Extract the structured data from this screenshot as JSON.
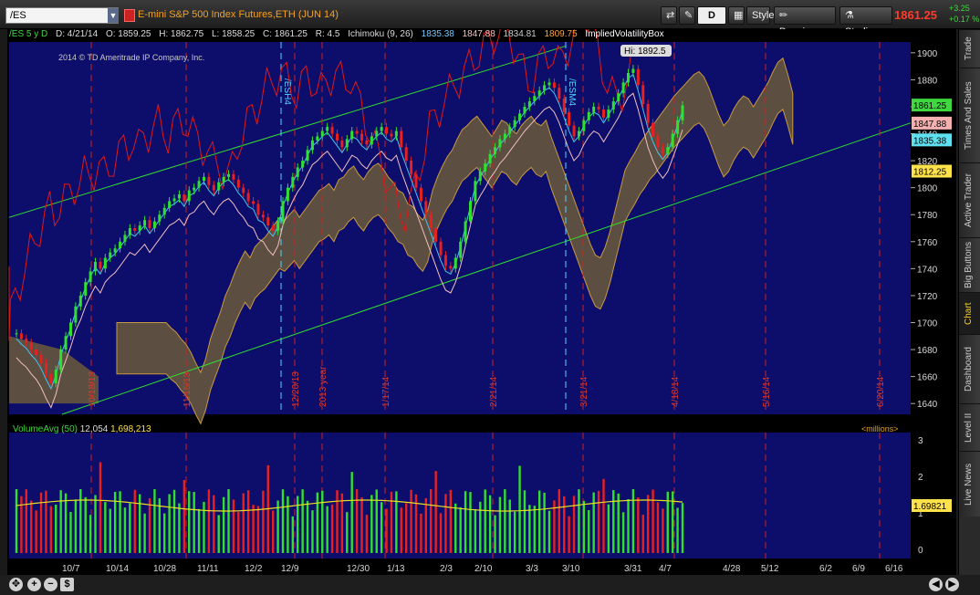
{
  "toolbar": {
    "symbol": "/ES",
    "description": "E-mini S&P 500 Index Futures,ETH (JUN 14)",
    "btn_d": "D",
    "style": "Style",
    "drawings": "Drawings",
    "studies": "Studies",
    "last": "1861.25",
    "change_pts": "+3.25",
    "change_pct": "+0.17 %"
  },
  "side_tabs": [
    "Trade",
    "Times And Sales",
    "Active Trader",
    "Big Buttons",
    "Chart",
    "Dashboard",
    "Level II",
    "Live News"
  ],
  "active_tab": "Chart",
  "header": {
    "ticker": "/ES 5 y D",
    "date": "D: 4/21/14",
    "open": "O: 1859.25",
    "high": "H: 1862.75",
    "low": "L: 1858.25",
    "close": "C: 1861.25",
    "range": "R: 4.5",
    "ichimoku": "Ichimoku (9, 26)",
    "v1": "1835.38",
    "v2": "1847.88",
    "v3": "1834.81",
    "v4": "1809.75",
    "ivb": "ImpliedVolatilityBox"
  },
  "copyright": "2014 © TD Ameritrade IP Company, Inc.",
  "volume": {
    "label": "VolumeAvg (50)",
    "v1": "12,054",
    "v2": "1,698,213",
    "units": "<millions>",
    "avg_tag": "1.69821"
  },
  "chart_data": {
    "type": "candlestick",
    "price_axis": [
      1900,
      1880,
      1860,
      1840,
      1820,
      1800,
      1780,
      1760,
      1740,
      1720,
      1700,
      1680,
      1660,
      1640
    ],
    "ylim": [
      1632,
      1908
    ],
    "volume_axis": [
      3,
      2,
      1,
      0
    ],
    "price_tags": [
      {
        "value": 1861.25,
        "label": "1861.25",
        "bg": "#3fd83f"
      },
      {
        "value": 1847.88,
        "label": "1847.88",
        "bg": "#f4b0b0"
      },
      {
        "value": 1835.38,
        "label": "1835.38",
        "bg": "#5ee0f0"
      },
      {
        "value": 1812.25,
        "label": "1812.25",
        "bg": "#ffe24a"
      }
    ],
    "high_marker": "Hi: 1892.5",
    "x_labels": [
      "10/7",
      "10/14",
      "10/28",
      "11/11",
      "12/2",
      "12/9",
      "12/30",
      "1/13",
      "2/3",
      "2/10",
      "3/3",
      "3/10",
      "3/31",
      "4/7",
      "4/28",
      "5/12",
      "6/2",
      "6/9",
      "6/16"
    ],
    "date_lines": [
      {
        "label": "10/18/13"
      },
      {
        "label": "11/15/13"
      },
      {
        "label": "12/20/13"
      },
      {
        "label": "2013 year"
      },
      {
        "label": "1/17/14"
      },
      {
        "label": "2/21/14"
      },
      {
        "label": "3/21/14"
      },
      {
        "label": "4/18/14"
      },
      {
        "label": "5/16/14"
      },
      {
        "label": "6/20/14"
      }
    ],
    "expiry_lines": [
      {
        "label": "/ESH4"
      },
      {
        "label": "/ESM4"
      }
    ],
    "close_series": [
      1692,
      1688,
      1685,
      1680,
      1676,
      1670,
      1662,
      1655,
      1665,
      1680,
      1690,
      1700,
      1712,
      1720,
      1730,
      1738,
      1745,
      1740,
      1748,
      1752,
      1755,
      1760,
      1765,
      1770,
      1768,
      1772,
      1776,
      1770,
      1775,
      1780,
      1785,
      1790,
      1792,
      1795,
      1790,
      1798,
      1800,
      1805,
      1808,
      1802,
      1798,
      1804,
      1808,
      1810,
      1806,
      1800,
      1796,
      1790,
      1788,
      1780,
      1778,
      1772,
      1768,
      1775,
      1790,
      1800,
      1808,
      1815,
      1820,
      1828,
      1835,
      1838,
      1842,
      1845,
      1840,
      1835,
      1830,
      1836,
      1842,
      1840,
      1835,
      1832,
      1838,
      1842,
      1845,
      1840,
      1838,
      1842,
      1830,
      1820,
      1810,
      1800,
      1790,
      1780,
      1770,
      1760,
      1750,
      1742,
      1740,
      1748,
      1760,
      1775,
      1790,
      1805,
      1812,
      1818,
      1825,
      1830,
      1836,
      1840,
      1845,
      1850,
      1855,
      1860,
      1864,
      1868,
      1872,
      1876,
      1878,
      1874,
      1866,
      1856,
      1846,
      1838,
      1842,
      1850,
      1856,
      1860,
      1858,
      1852,
      1858,
      1864,
      1870,
      1878,
      1885,
      1888,
      1876,
      1862,
      1848,
      1838,
      1830,
      1825,
      1830,
      1840,
      1850,
      1861
    ]
  }
}
